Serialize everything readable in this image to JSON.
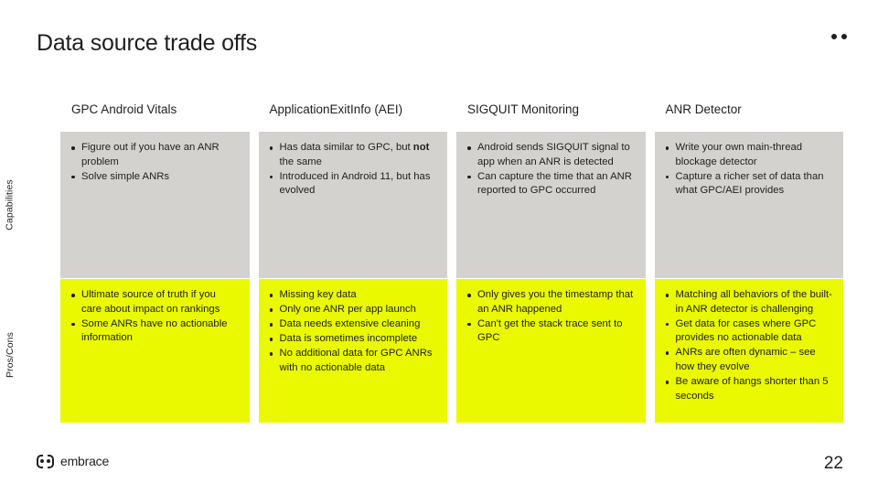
{
  "slide": {
    "title": "Data source trade offs",
    "page_number": "22",
    "corner_dots_count": 2,
    "logo_text": "embrace",
    "colors": {
      "capabilities_cell_bg": "#d4d2cf",
      "proscons_cell_bg": "#eaf900",
      "text": "#1f1f1f",
      "background": "#ffffff"
    }
  },
  "row_labels": {
    "capabilities": "Capabilities",
    "pros_cons": "Pros/Cons"
  },
  "columns": [
    {
      "header": "GPC Android Vitals",
      "capabilities": [
        "Figure out if you have an ANR problem",
        "Solve simple ANRs"
      ],
      "pros_cons": [
        "Ultimate source of truth if you care about impact on rankings",
        "Some ANRs have no actionable information"
      ]
    },
    {
      "header": "ApplicationExitInfo (AEI)",
      "capabilities_html": [
        "Has data similar to GPC, but <b>not</b> the same",
        "Introduced in Android 11, but has evolved"
      ],
      "capabilities": [
        "Has data similar to GPC, but not the same",
        "Introduced in Android 11, but has evolved"
      ],
      "pros_cons": [
        "Missing key data",
        "Only one ANR per app launch",
        "Data needs extensive cleaning",
        "Data is sometimes incomplete",
        "No additional data for GPC ANRs with no actionable data"
      ]
    },
    {
      "header": "SIGQUIT Monitoring",
      "capabilities": [
        "Android sends SIGQUIT signal to app when an ANR is detected",
        "Can capture the time that an ANR reported to GPC occurred"
      ],
      "pros_cons": [
        "Only gives you the timestamp that an ANR happened",
        "Can't get the stack trace sent to GPC"
      ]
    },
    {
      "header": "ANR Detector",
      "capabilities": [
        "Write your own main-thread blockage detector",
        "Capture a richer set of data than what GPC/AEI provides"
      ],
      "pros_cons": [
        "Matching all behaviors of the built-in ANR detector is challenging",
        "Get data for cases where GPC provides no actionable data",
        "ANRs are often dynamic – see how they evolve",
        "Be aware of hangs shorter than 5 seconds"
      ]
    }
  ]
}
